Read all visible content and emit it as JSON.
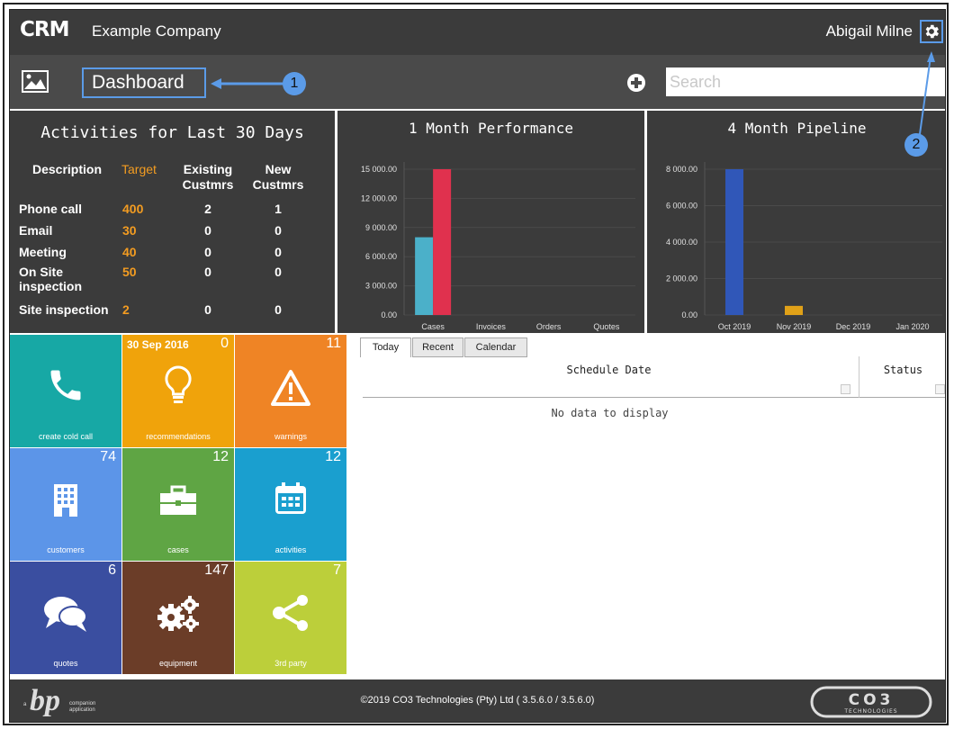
{
  "header": {
    "logo_text": "CRM",
    "company": "Example Company",
    "user": "Abigail Milne",
    "settings_icon": "gear-icon"
  },
  "titlebar": {
    "image_icon": "image-icon",
    "page_title": "Dashboard",
    "add_icon": "plus-circle-icon",
    "search_placeholder": "Search"
  },
  "callouts": [
    "1",
    "2"
  ],
  "activities": {
    "title": "Activities for Last 30 Days",
    "headers": {
      "description": "Description",
      "target": "Target",
      "existing_1": "Existing",
      "existing_2": "Custmrs",
      "new_1": "New",
      "new_2": "Custmrs"
    },
    "rows": [
      {
        "description_1": "Phone call",
        "description_2": "",
        "target": "400",
        "existing": "2",
        "new": "1"
      },
      {
        "description_1": "Email",
        "description_2": "",
        "target": "30",
        "existing": "0",
        "new": "0"
      },
      {
        "description_1": "Meeting",
        "description_2": "",
        "target": "40",
        "existing": "0",
        "new": "0"
      },
      {
        "description_1": "On Site",
        "description_2": "inspection",
        "target": "50",
        "existing": "0",
        "new": "0"
      },
      {
        "description_1": "Site inspection",
        "description_2": "",
        "target": "2",
        "existing": "0",
        "new": "0"
      }
    ],
    "target_color": "#f39c21"
  },
  "chart_data": [
    {
      "type": "bar",
      "title": "1 Month Performance",
      "categories": [
        "Cases",
        "Invoices",
        "Orders",
        "Quotes"
      ],
      "series": [
        {
          "values": [
            8000,
            0,
            0,
            0
          ],
          "color": "#4bb0c9"
        },
        {
          "values": [
            15000,
            0,
            0,
            0
          ],
          "color": "#e0314e"
        }
      ],
      "yticks": [
        "15 000.00",
        "12 000.00",
        "9 000.00",
        "6 000.00",
        "3 000.00",
        "0.00"
      ],
      "ylim": [
        0,
        15000
      ],
      "grid": true
    },
    {
      "type": "bar",
      "title": "4 Month Pipeline",
      "categories": [
        "Oct 2019",
        "Nov 2019",
        "Dec 2019",
        "Jan 2020"
      ],
      "series": [
        {
          "values": [
            8000,
            500,
            0,
            0
          ],
          "colors": [
            "#3057b8",
            "#e0a118",
            "#3057b8",
            "#3057b8"
          ]
        }
      ],
      "yticks": [
        "8 000.00",
        "6 000.00",
        "4 000.00",
        "2 000.00",
        "0.00"
      ],
      "ylim": [
        0,
        8000
      ],
      "grid": true
    }
  ],
  "tiles": [
    {
      "label": "create cold call",
      "count": "",
      "date": "",
      "icon": "phone-icon",
      "color": "#17a8a5"
    },
    {
      "label": "recommendations",
      "count": "0",
      "date": "30 Sep 2016",
      "icon": "lightbulb-icon",
      "color": "#f0a30b"
    },
    {
      "label": "warnings",
      "count": "11",
      "date": "",
      "icon": "warning-icon",
      "color": "#ef8425"
    },
    {
      "label": "customers",
      "count": "74",
      "date": "",
      "icon": "building-icon",
      "color": "#5c95e8"
    },
    {
      "label": "cases",
      "count": "12",
      "date": "",
      "icon": "briefcase-icon",
      "color": "#5fa544"
    },
    {
      "label": "activities",
      "count": "12",
      "date": "",
      "icon": "calendar-icon",
      "color": "#1a9fcf"
    },
    {
      "label": "quotes",
      "count": "6",
      "date": "",
      "icon": "chat-bubbles-icon",
      "color": "#3a4ea0"
    },
    {
      "label": "equipment",
      "count": "147",
      "date": "",
      "icon": "gears-icon",
      "color": "#6b3d28"
    },
    {
      "label": "3rd party",
      "count": "7",
      "date": "",
      "icon": "share-icon",
      "color": "#bccf3a"
    }
  ],
  "schedule": {
    "tabs": [
      "Today",
      "Recent",
      "Calendar"
    ],
    "active_tab": "Today",
    "columns": [
      "Schedule Date",
      "Status"
    ],
    "empty_text": "No data to display"
  },
  "footer": {
    "bp_logo": "bp",
    "bp_tagline_prefix": "a",
    "bp_tagline_1": "companion",
    "bp_tagline_2": "application",
    "copyright": "©2019 CO3 Technologies (Pty) Ltd ( 3.5.6.0 / 3.5.6.0)",
    "co3_logo": "CO3",
    "co3_sub": "TECHNOLOGIES"
  }
}
